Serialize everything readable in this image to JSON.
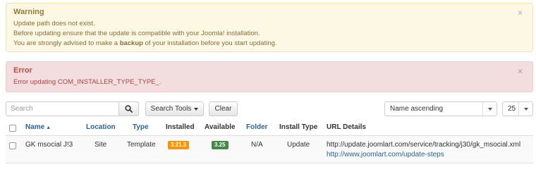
{
  "warning": {
    "heading": "Warning",
    "line1": "Update path does not exist.",
    "line2": "Before updating ensure that the update is compatible with your Joomla! installation.",
    "line3_before": "You are strongly advised to make a ",
    "line3_bold": "backup",
    "line3_after": " of your installation before you start updating.",
    "close": "×"
  },
  "error": {
    "heading": "Error",
    "message": "Error updating COM_INSTALLER_TYPE_TYPE_.",
    "close": "×"
  },
  "toolbar": {
    "search_placeholder": "Search",
    "search_tools_label": "Search Tools",
    "clear_label": "Clear",
    "sort_value": "Name ascending",
    "limit_value": "25"
  },
  "table": {
    "headers": {
      "name": "Name",
      "name_sort_indicator": "▲",
      "location": "Location",
      "type": "Type",
      "installed": "Installed",
      "available": "Available",
      "folder": "Folder",
      "install_type": "Install Type",
      "url_details": "URL Details"
    },
    "rows": [
      {
        "name": "GK msocial J!3",
        "location": "Site",
        "type": "Template",
        "installed": "3.21.3",
        "available": "3.25",
        "folder": "N/A",
        "install_type": "Update",
        "url_primary": "http://update.joomlart.com/service/tracking/j30/gk_msocial.xml",
        "url_secondary": "http://www.joomlart.com/update-steps"
      }
    ]
  },
  "colors": {
    "link": "#2a6496",
    "badge_installed": "#f89406",
    "badge_available": "#468847",
    "warning_bg": "#fcf8e3",
    "error_bg": "#f2dede"
  }
}
